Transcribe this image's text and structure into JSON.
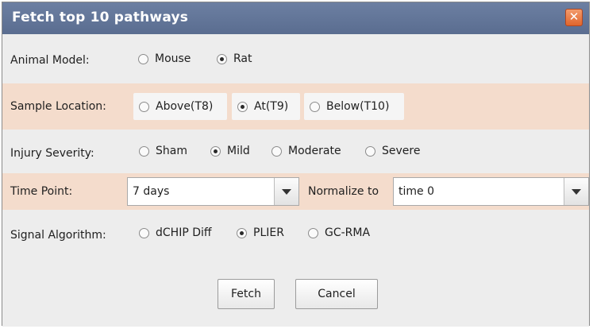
{
  "window": {
    "title": "Fetch top 10 pathways",
    "close_symbol": "✕"
  },
  "animal_model": {
    "label": "Animal Model:",
    "options": [
      {
        "label": "Mouse",
        "selected": false
      },
      {
        "label": "Rat",
        "selected": true
      }
    ]
  },
  "sample_location": {
    "label": "Sample Location:",
    "options": [
      {
        "label": "Above(T8)",
        "selected": false
      },
      {
        "label": "At(T9)",
        "selected": true
      },
      {
        "label": "Below(T10)",
        "selected": false
      }
    ]
  },
  "injury_severity": {
    "label": "Injury Severity:",
    "options": [
      {
        "label": "Sham",
        "selected": false
      },
      {
        "label": "Mild",
        "selected": true
      },
      {
        "label": "Moderate",
        "selected": false
      },
      {
        "label": "Severe",
        "selected": false
      }
    ]
  },
  "time_point": {
    "label": "Time Point:",
    "value": "7 days"
  },
  "normalize": {
    "label": "Normalize to",
    "value": "time 0"
  },
  "signal_algorithm": {
    "label": "Signal Algorithm:",
    "options": [
      {
        "label": "dCHIP Diff",
        "selected": false
      },
      {
        "label": "PLIER",
        "selected": true
      },
      {
        "label": "GC-RMA",
        "selected": false
      }
    ]
  },
  "buttons": {
    "fetch": "Fetch",
    "cancel": "Cancel"
  },
  "colors": {
    "titlebar": "#5f7296",
    "highlight_band": "#f4dccc",
    "background": "#ededed"
  }
}
